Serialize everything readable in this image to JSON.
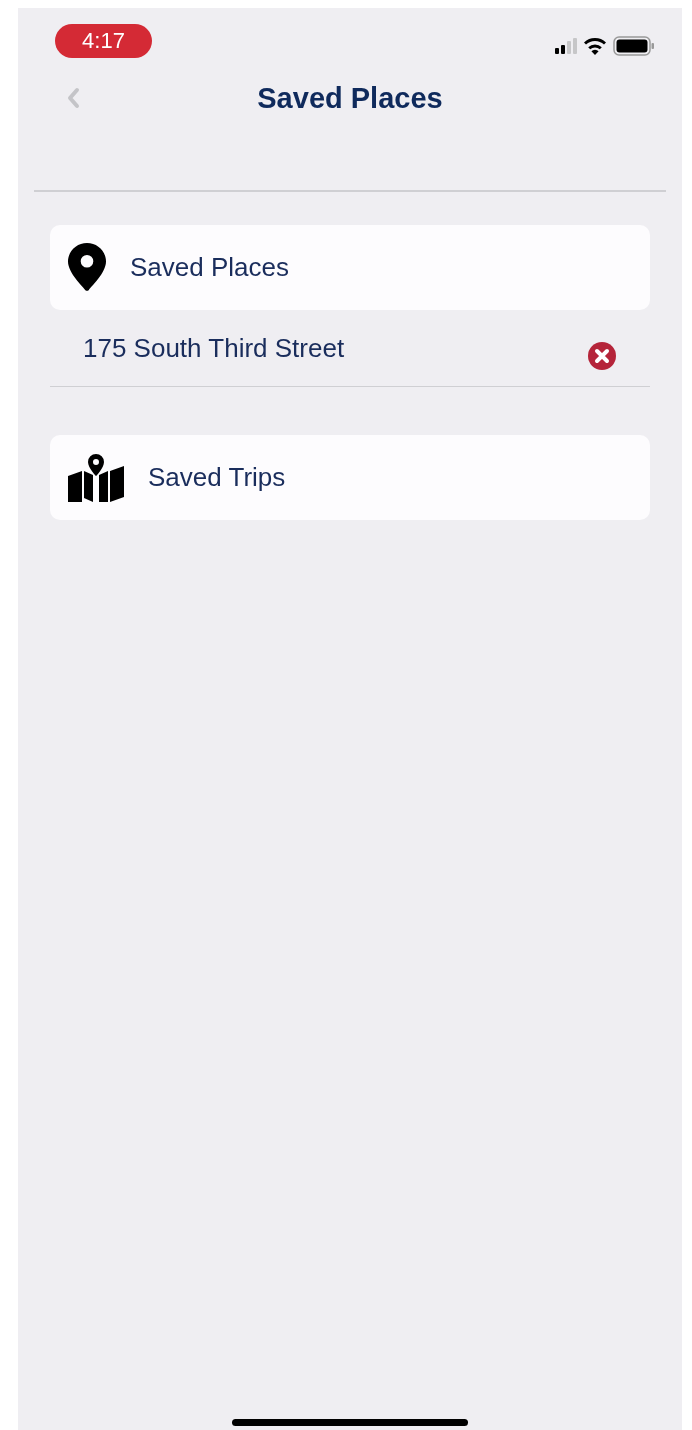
{
  "status_bar": {
    "time": "4:17"
  },
  "nav": {
    "title": "Saved Places"
  },
  "sections": [
    {
      "kind": "pin",
      "title": "Saved Places",
      "items": [
        {
          "label": "175 South Third Street"
        }
      ]
    },
    {
      "kind": "map",
      "title": "Saved Trips"
    }
  ]
}
